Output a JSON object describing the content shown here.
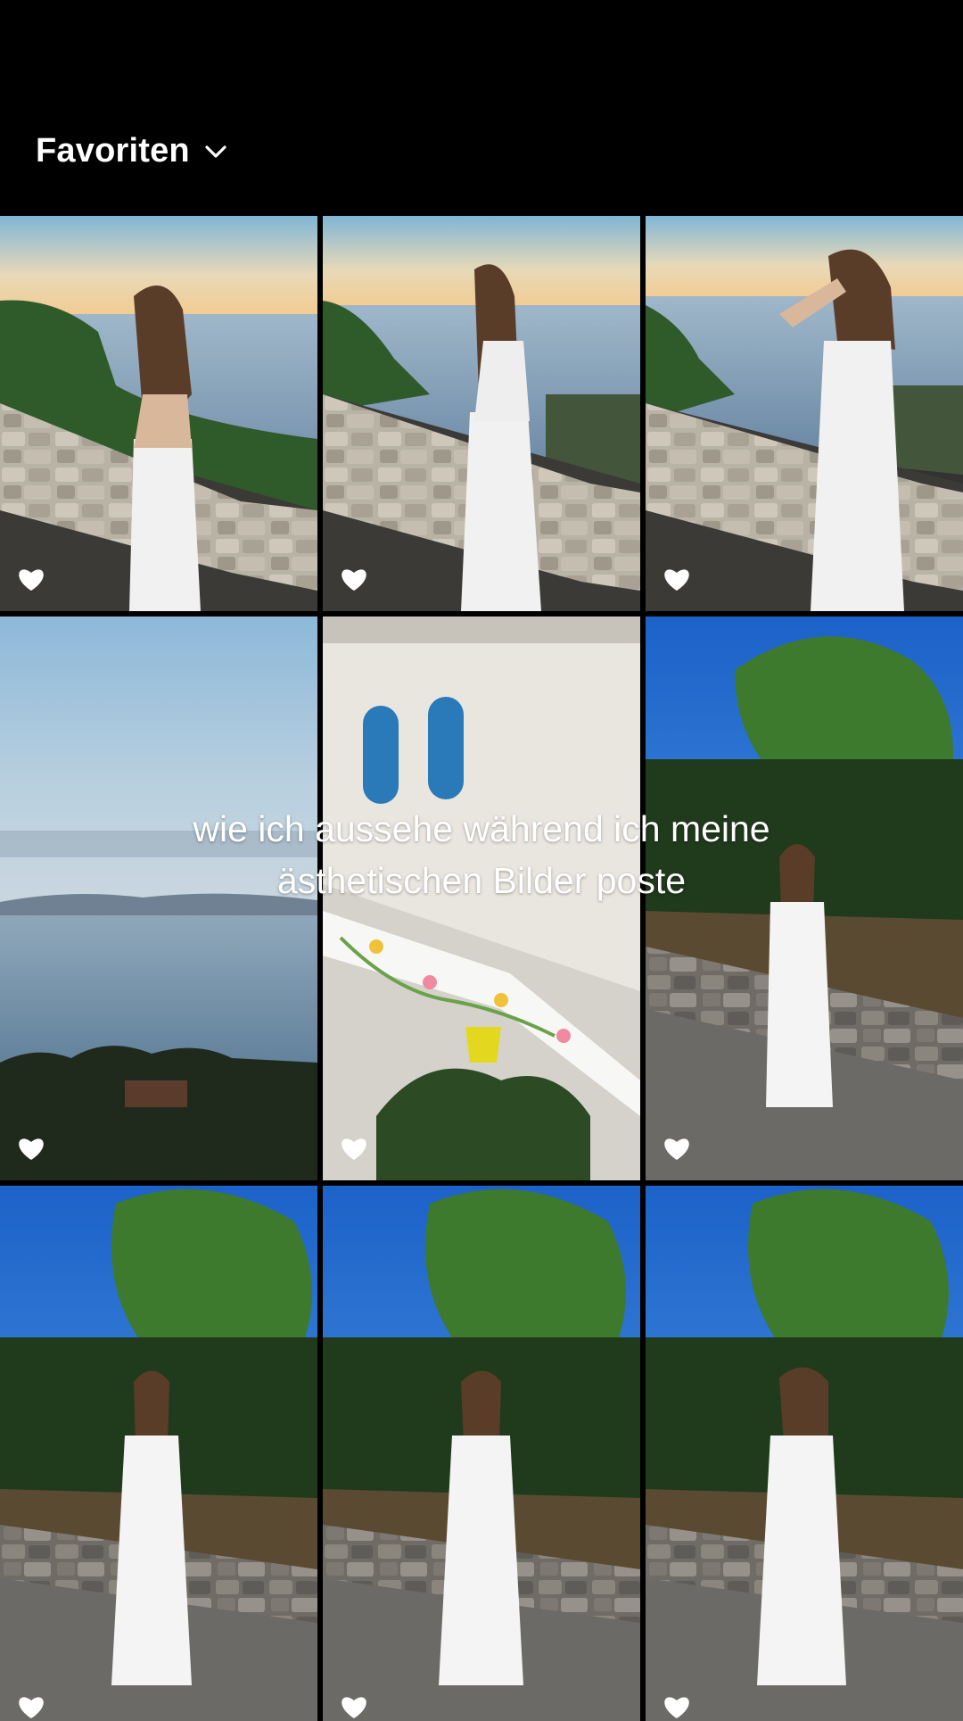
{
  "header": {
    "album_title": "Favoriten",
    "dropdown_icon": "chevron-down-icon"
  },
  "overlay_caption": {
    "line1": "wie ich aussehe während ich meine",
    "line2": "ästhetischen Bilder poste"
  },
  "grid": {
    "columns": 3,
    "favorite_icon": "heart-icon",
    "photos": [
      {
        "scene": "sunset-sea-wall-back",
        "favorite": true
      },
      {
        "scene": "sunset-sea-wall-side",
        "favorite": true
      },
      {
        "scene": "sunset-sea-wall-hand-hair",
        "favorite": true
      },
      {
        "scene": "sea-horizon-landscape",
        "favorite": true
      },
      {
        "scene": "white-house-painted-stairs",
        "favorite": true
      },
      {
        "scene": "garden-terrace-full-body",
        "favorite": true
      },
      {
        "scene": "garden-terrace-pose-1",
        "favorite": true
      },
      {
        "scene": "garden-terrace-pose-2",
        "favorite": true
      },
      {
        "scene": "garden-terrace-pose-3",
        "favorite": true
      }
    ]
  },
  "colors": {
    "background": "#000000",
    "text": "#ffffff"
  }
}
